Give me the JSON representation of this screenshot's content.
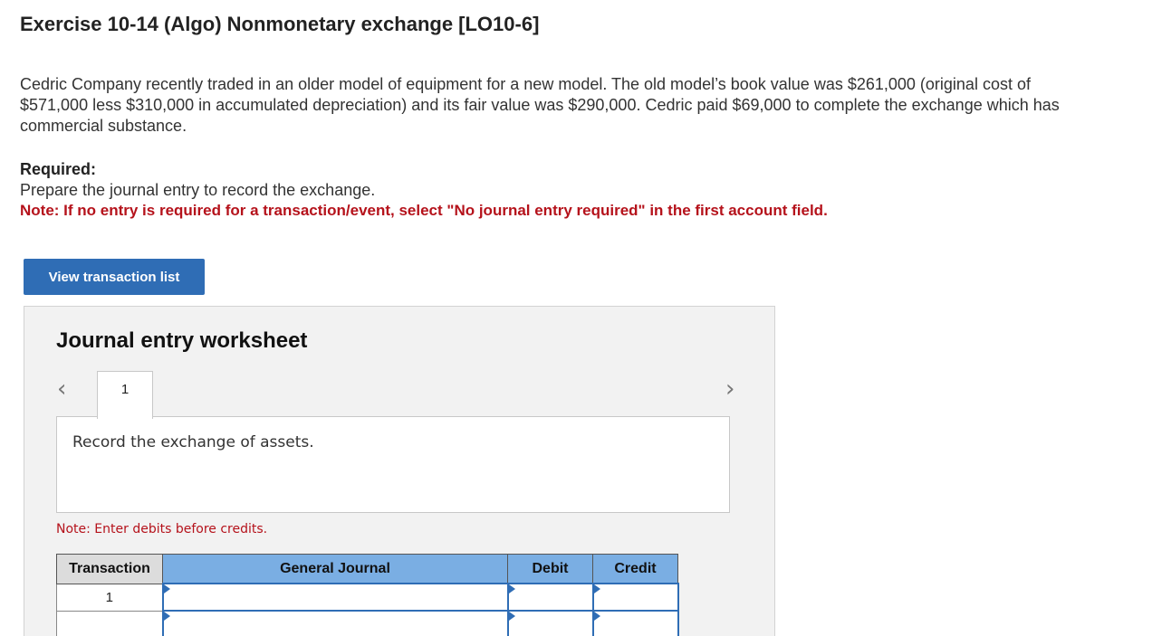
{
  "header": {
    "title": "Exercise 10-14 (Algo) Nonmonetary exchange [LO10-6]"
  },
  "problem": {
    "text": "Cedric Company recently traded in an older model of equipment for a new model. The old model’s book value was $261,000 (original cost of $571,000 less $310,000 in accumulated depreciation) and its fair value was $290,000. Cedric paid $69,000 to complete the exchange which has commercial substance."
  },
  "required": {
    "label": "Required:",
    "text": "Prepare the journal entry to record the exchange.",
    "note": "Note: If no entry is required for a transaction/event, select \"No journal entry required\" in the first account field."
  },
  "buttons": {
    "view_transaction_list": "View transaction list"
  },
  "worksheet": {
    "title": "Journal entry worksheet",
    "prev_glyph": "‹",
    "next_glyph": "›",
    "tabs": [
      {
        "label": "1"
      }
    ],
    "record_instruction": "Record the exchange of assets.",
    "note": "Note: Enter debits before credits.",
    "table": {
      "headers": {
        "transaction": "Transaction",
        "general_journal": "General Journal",
        "debit": "Debit",
        "credit": "Credit"
      },
      "rows": [
        {
          "transaction": "1",
          "account": "",
          "debit": "",
          "credit": ""
        },
        {
          "transaction": "",
          "account": "",
          "debit": "",
          "credit": ""
        }
      ]
    }
  },
  "colors": {
    "button_blue": "#2f6db5",
    "header_blue": "#7aaee3",
    "note_red": "#b5121b",
    "worksheet_bg": "#f2f2f2"
  }
}
